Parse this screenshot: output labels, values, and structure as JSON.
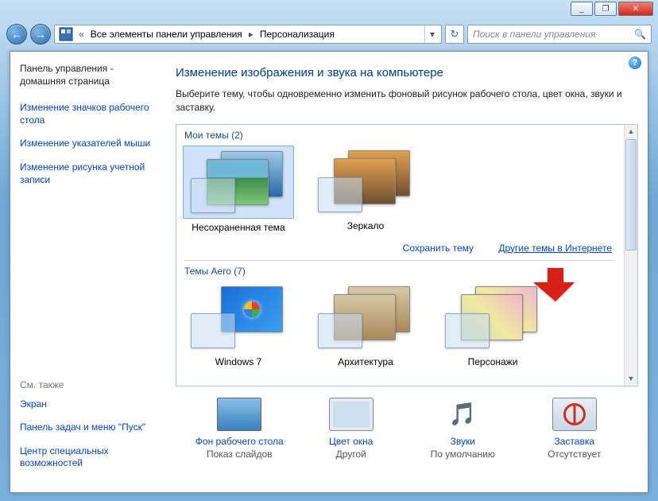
{
  "titlebar": {
    "min": "_",
    "max": "❐",
    "close": "✕"
  },
  "nav": {
    "back": "←",
    "fwd": "→",
    "bc_prefix": "«",
    "bc1": "Все элементы панели управления",
    "bc2": "Персонализация",
    "refresh": "↻"
  },
  "search": {
    "placeholder": "Поиск в панели управления",
    "glass": "🔍"
  },
  "sidebar": {
    "title": "Панель управления - домашняя страница",
    "links": [
      "Изменение значков рабочего стола",
      "Изменение указателей мыши",
      "Изменение рисунка учетной записи"
    ],
    "see_also": "См. также",
    "extras": [
      "Экран",
      "Панель задач и меню \"Пуск\"",
      "Центр специальных возможностей"
    ]
  },
  "main": {
    "heading": "Изменение изображения и звука на компьютере",
    "desc": "Выберите тему, чтобы одновременно изменить фоновый рисунок рабочего стола, цвет окна, звуки и заставку.",
    "group_my": "Мои темы (2)",
    "my_themes": [
      "Несохраненная тема",
      "Зеркало"
    ],
    "save_link": "Сохранить тему",
    "more_link": "Другие темы в Интернете",
    "group_aero": "Темы Aero (7)",
    "aero_themes": [
      "Windows 7",
      "Архитектура",
      "Персонажи"
    ]
  },
  "bottom": {
    "items": [
      {
        "title": "Фон рабочего стола",
        "sub": "Показ слайдов"
      },
      {
        "title": "Цвет окна",
        "sub": "Другой"
      },
      {
        "title": "Звуки",
        "sub": "По умолчанию"
      },
      {
        "title": "Заставка",
        "sub": "Отсутствует"
      }
    ]
  }
}
